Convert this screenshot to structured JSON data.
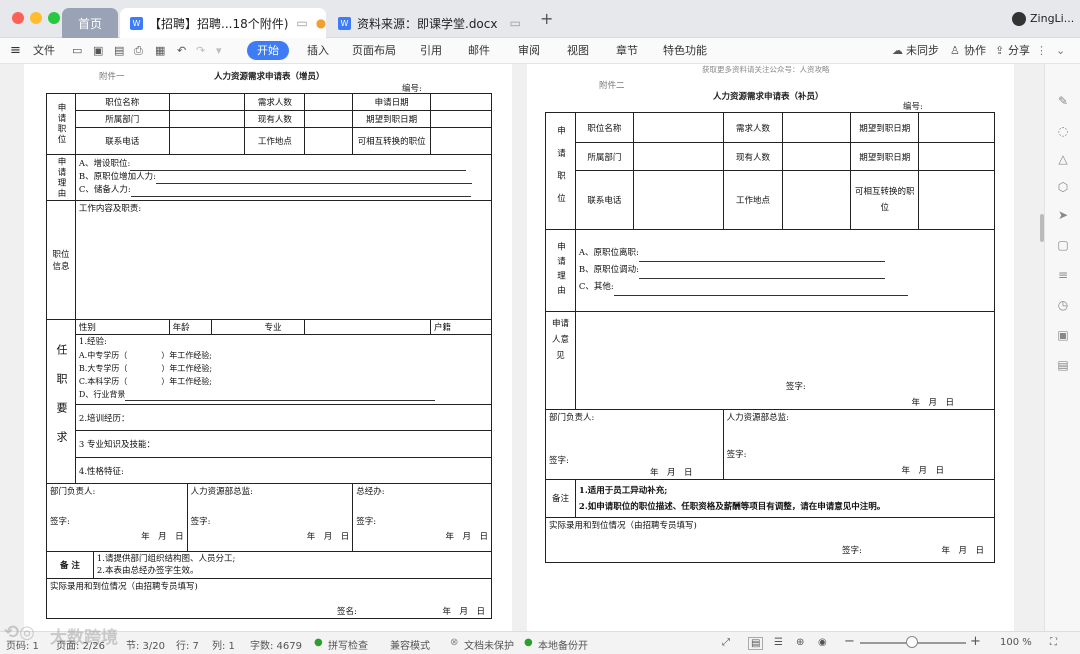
{
  "window": {
    "home_tab": "首页",
    "tabs": [
      {
        "title": "【招聘】招聘...18个附件)",
        "active": true
      },
      {
        "title": "资料来源：即课学堂.docx",
        "active": false
      }
    ],
    "user": "ZingLi..."
  },
  "toolbar": {
    "file": "文件",
    "menus": [
      "开始",
      "插入",
      "页面布局",
      "引用",
      "邮件",
      "审阅",
      "视图",
      "章节",
      "特色功能"
    ],
    "sync": "未同步",
    "collab": "协作",
    "share": "分享"
  },
  "left_page": {
    "attachment": "附件一",
    "title": "人力资源需求申请表（增员）",
    "number_label": "编号:",
    "pos_label": "申请职位",
    "pos_name": "职位名称",
    "need_count": "需求人数",
    "apply_date": "申请日期",
    "dept": "所属部门",
    "current_count": "现有人数",
    "expect_date": "期望到职日期",
    "phone": "联系电话",
    "work_place": "工作地点",
    "switchable": "可相互转换的职位",
    "reason_label": "申请理由",
    "reason_a": "A、增设职位:",
    "reason_b": "B、原职位增加人力:",
    "reason_c": "C、储备人力:",
    "info_label": "职位信息",
    "duties": "工作内容及职责:",
    "req_label": "任职要求",
    "gender": "性别",
    "age": "年龄",
    "major": "专业",
    "hukou": "户籍",
    "exp": "1.经验:",
    "exp_a": "A.中专学历（",
    "exp_b": "B.大专学历（",
    "exp_c": "C.本科学历（",
    "exp_years": "）年工作经验;",
    "exp_d": "D、行业背景",
    "training": "2.培训经历：",
    "skills": "3 专业知识及技能：",
    "traits": "4.性格特征:",
    "dept_head": "部门负责人:",
    "hr_director": "人力资源部总监:",
    "gm": "总经办:",
    "sign": "签字:",
    "ymd": "年　月　日",
    "remarks": "备 注",
    "remark1": "1.请提供部门组织结构图、人员分工;",
    "remark2": "2.本表由总经办签字生效。",
    "actual": "实际录用和到位情况（由招聘专员填写)",
    "sign2": "签名:"
  },
  "right_page": {
    "header_note": "获取更多资料请关注公众号：人资攻略",
    "attachment": "附件二",
    "title": "人力资源需求申请表（补员）",
    "number_label": "编号:",
    "pos_label": "申请职位",
    "pos_name": "职位名称",
    "need_count": "需求人数",
    "expect_date": "期望到职日期",
    "dept": "所属部门",
    "current_count": "现有人数",
    "phone": "联系电话",
    "work_place": "工作地点",
    "switchable": "可相互转换的职位",
    "reason_label": "申请理由",
    "reason_a": "A、原职位离职:",
    "reason_b": "B、原职位调动:",
    "reason_c": "C、其他:",
    "opinion_label": "申请人意见",
    "sign": "签字:",
    "ymd": "年　月　日",
    "dept_head": "部门负责人:",
    "hr_director": "人力资源部总监:",
    "remarks": "备注",
    "remark1": "1.适用于员工异动补充;",
    "remark2": "2.如申请职位的职位描述、任职资格及薪酬等项目有调整，请在申请意见中注明。",
    "actual": "实际录用和到位情况（由招聘专员填写)"
  },
  "status": {
    "page": "页码: 1",
    "pages": "页面: 2/26",
    "section": "节: 3/20",
    "row": "行: 7",
    "col": "列: 1",
    "words": "字数: 4679",
    "spell": "拼写检查",
    "compat": "兼容模式",
    "unprotected": "文档未保护",
    "backup": "本地备份开",
    "zoom": "100 %",
    "watermark": "大数跨境"
  }
}
